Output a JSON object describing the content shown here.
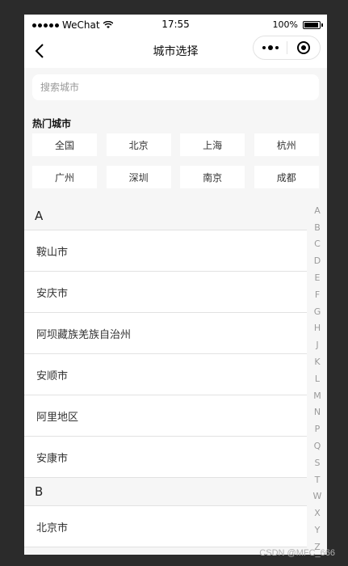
{
  "status_bar": {
    "carrier": "WeChat",
    "time": "17:55",
    "battery": "100%",
    "battery_level": 1.0
  },
  "navbar": {
    "title": "城市选择",
    "back_icon": "chevron-left-icon",
    "more_icon": "more-dots-icon",
    "close_icon": "target-close-icon"
  },
  "search": {
    "placeholder": "搜索城市",
    "value": ""
  },
  "hot": {
    "title": "热门城市",
    "cities": [
      "全国",
      "北京",
      "上海",
      "杭州",
      "广州",
      "深圳",
      "南京",
      "成都"
    ]
  },
  "groups": [
    {
      "letter": "A",
      "cities": [
        "鞍山市",
        "安庆市",
        "阿坝藏族羌族自治州",
        "安顺市",
        "阿里地区",
        "安康市"
      ]
    },
    {
      "letter": "B",
      "cities": [
        "北京市"
      ]
    }
  ],
  "index_letters": [
    "A",
    "B",
    "C",
    "D",
    "E",
    "F",
    "G",
    "H",
    "J",
    "K",
    "L",
    "M",
    "N",
    "P",
    "Q",
    "S",
    "T",
    "W",
    "X",
    "Y",
    "Z"
  ],
  "watermark": "CSDN @MFC_666"
}
